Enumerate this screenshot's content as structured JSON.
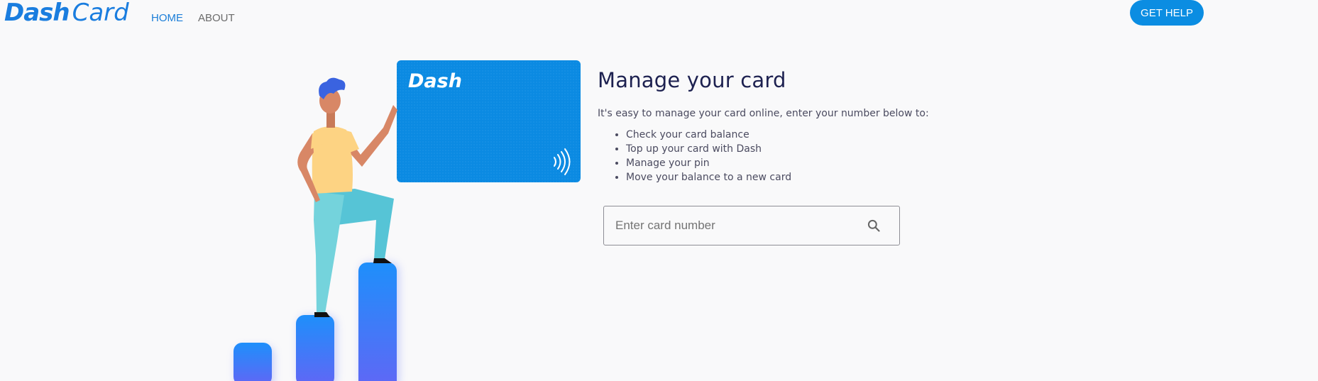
{
  "header": {
    "logo_primary": "Dash",
    "logo_secondary": "Card",
    "nav": [
      {
        "label": "HOME",
        "active": true
      },
      {
        "label": "ABOUT",
        "active": false
      }
    ],
    "help_button": "GET HELP"
  },
  "hero": {
    "card_brand": "Dash",
    "contactless_icon": "contactless-icon"
  },
  "main": {
    "title": "Manage your card",
    "intro": "It's easy to manage your card online, enter your number below to:",
    "features": [
      "Check your card balance",
      "Top up your card with Dash",
      "Manage your pin",
      "Move your balance to a new card"
    ],
    "search": {
      "placeholder": "Enter card number",
      "value": "",
      "icon": "search-icon"
    }
  },
  "colors": {
    "brand": "#1a7ddf",
    "button": "#0b8de2",
    "card": "#0b8ae2",
    "title": "#1d2150"
  }
}
